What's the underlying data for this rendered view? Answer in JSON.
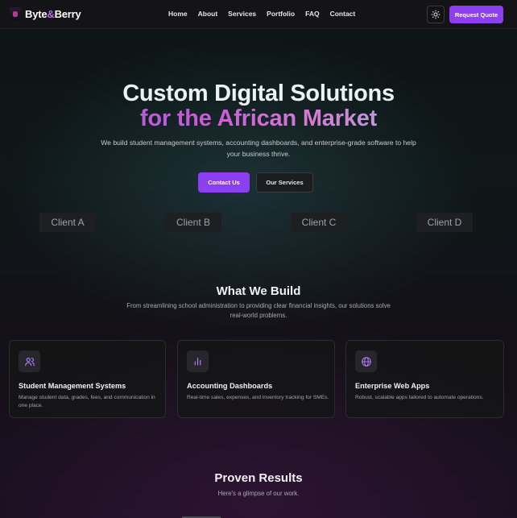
{
  "brand": {
    "name_a": "Byte",
    "name_amp": "&",
    "name_b": "Berry",
    "accent": "#8b3ff0"
  },
  "nav": {
    "links": [
      "Home",
      "About",
      "Services",
      "Portfolio",
      "FAQ",
      "Contact"
    ],
    "theme_toggle_icon": "sun-icon",
    "quote_label": "Request Quote"
  },
  "hero": {
    "title_line1": "Custom Digital Solutions",
    "title_line2": "for the African Market",
    "subtitle": "We build student management systems, accounting dashboards, and enterprise-grade software to help your business thrive.",
    "primary_cta": "Contact Us",
    "secondary_cta": "Our Services"
  },
  "clients": [
    "Client A",
    "Client B",
    "Client C",
    "Client D"
  ],
  "build": {
    "title": "What We Build",
    "subtitle": "From streamlining school administration to providing clear financial insights, our solutions solve real-world problems.",
    "cards": [
      {
        "icon": "users-icon",
        "title": "Student Management Systems",
        "desc": "Manage student data, grades, fees, and communication in one place."
      },
      {
        "icon": "bar-chart-icon",
        "title": "Accounting Dashboards",
        "desc": "Real-time sales, expenses, and inventory tracking for SMEs."
      },
      {
        "icon": "globe-icon",
        "title": "Enterprise Web Apps",
        "desc": "Robust, scalable apps tailored to automate operations."
      }
    ]
  },
  "results": {
    "title": "Proven Results",
    "subtitle": "Here's a glimpse of our work."
  }
}
